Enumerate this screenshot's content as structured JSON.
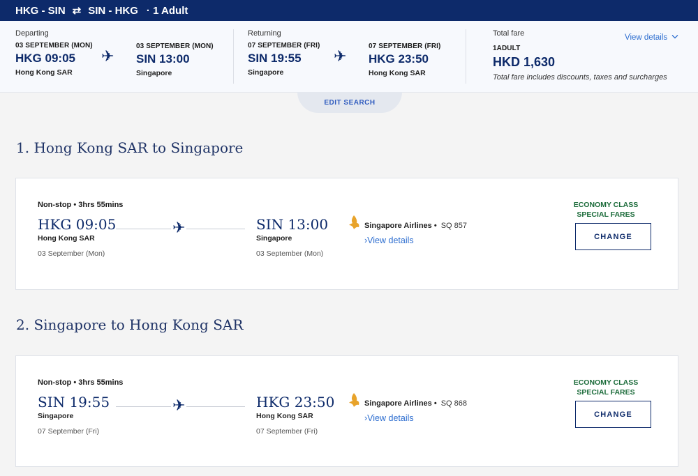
{
  "header": {
    "outbound_route": "HKG - SIN",
    "swap_icon": "arrows-swap-icon",
    "inbound_route": "SIN - HKG",
    "passengers": "· 1 Adult"
  },
  "summary": {
    "departing": {
      "label": "Departing",
      "from": {
        "date": "03 SEPTEMBER (MON)",
        "time": "HKG 09:05",
        "city": "Hong Kong SAR"
      },
      "to": {
        "date": "03 SEPTEMBER (MON)",
        "time": "SIN 13:00",
        "city": "Singapore"
      }
    },
    "returning": {
      "label": "Returning",
      "from": {
        "date": "07 SEPTEMBER (FRI)",
        "time": "SIN 19:55",
        "city": "Singapore"
      },
      "to": {
        "date": "07 SEPTEMBER (FRI)",
        "time": "HKG 23:50",
        "city": "Hong Kong SAR"
      }
    },
    "fare": {
      "label": "Total fare",
      "pax": "1ADULT",
      "amount": "HKD 1,630",
      "note": "Total fare includes discounts, taxes and surcharges",
      "view_details": "View details"
    }
  },
  "edit_search": "EDIT SEARCH",
  "flights": [
    {
      "title": "1. Hong Kong SAR to Singapore",
      "duration": "Non-stop • 3hrs 55mins",
      "dep_time": "HKG 09:05",
      "dep_city": "Hong Kong SAR",
      "dep_date": "03 September (Mon)",
      "arr_time": "SIN 13:00",
      "arr_city": "Singapore",
      "arr_date": "03 September (Mon)",
      "airline": "Singapore Airlines •",
      "flight_no": "SQ 857",
      "view_details": "›View details",
      "cabin_line1": "ECONOMY CLASS",
      "cabin_line2": "SPECIAL FARES",
      "change": "CHANGE"
    },
    {
      "title": "2. Singapore to Hong Kong SAR",
      "duration": "Non-stop • 3hrs 55mins",
      "dep_time": "SIN 19:55",
      "dep_city": "Singapore",
      "dep_date": "07 September (Fri)",
      "arr_time": "HKG 23:50",
      "arr_city": "Hong Kong SAR",
      "arr_date": "07 September (Fri)",
      "airline": "Singapore Airlines •",
      "flight_no": "SQ 868",
      "view_details": "›View details",
      "cabin_line1": "ECONOMY CLASS",
      "cabin_line2": "SPECIAL FARES",
      "change": "CHANGE"
    }
  ],
  "colors": {
    "navy": "#0d2a6a",
    "link": "#2f6fd0",
    "cabin_green": "#1b6b3a",
    "airline_gold": "#e8a32a"
  }
}
